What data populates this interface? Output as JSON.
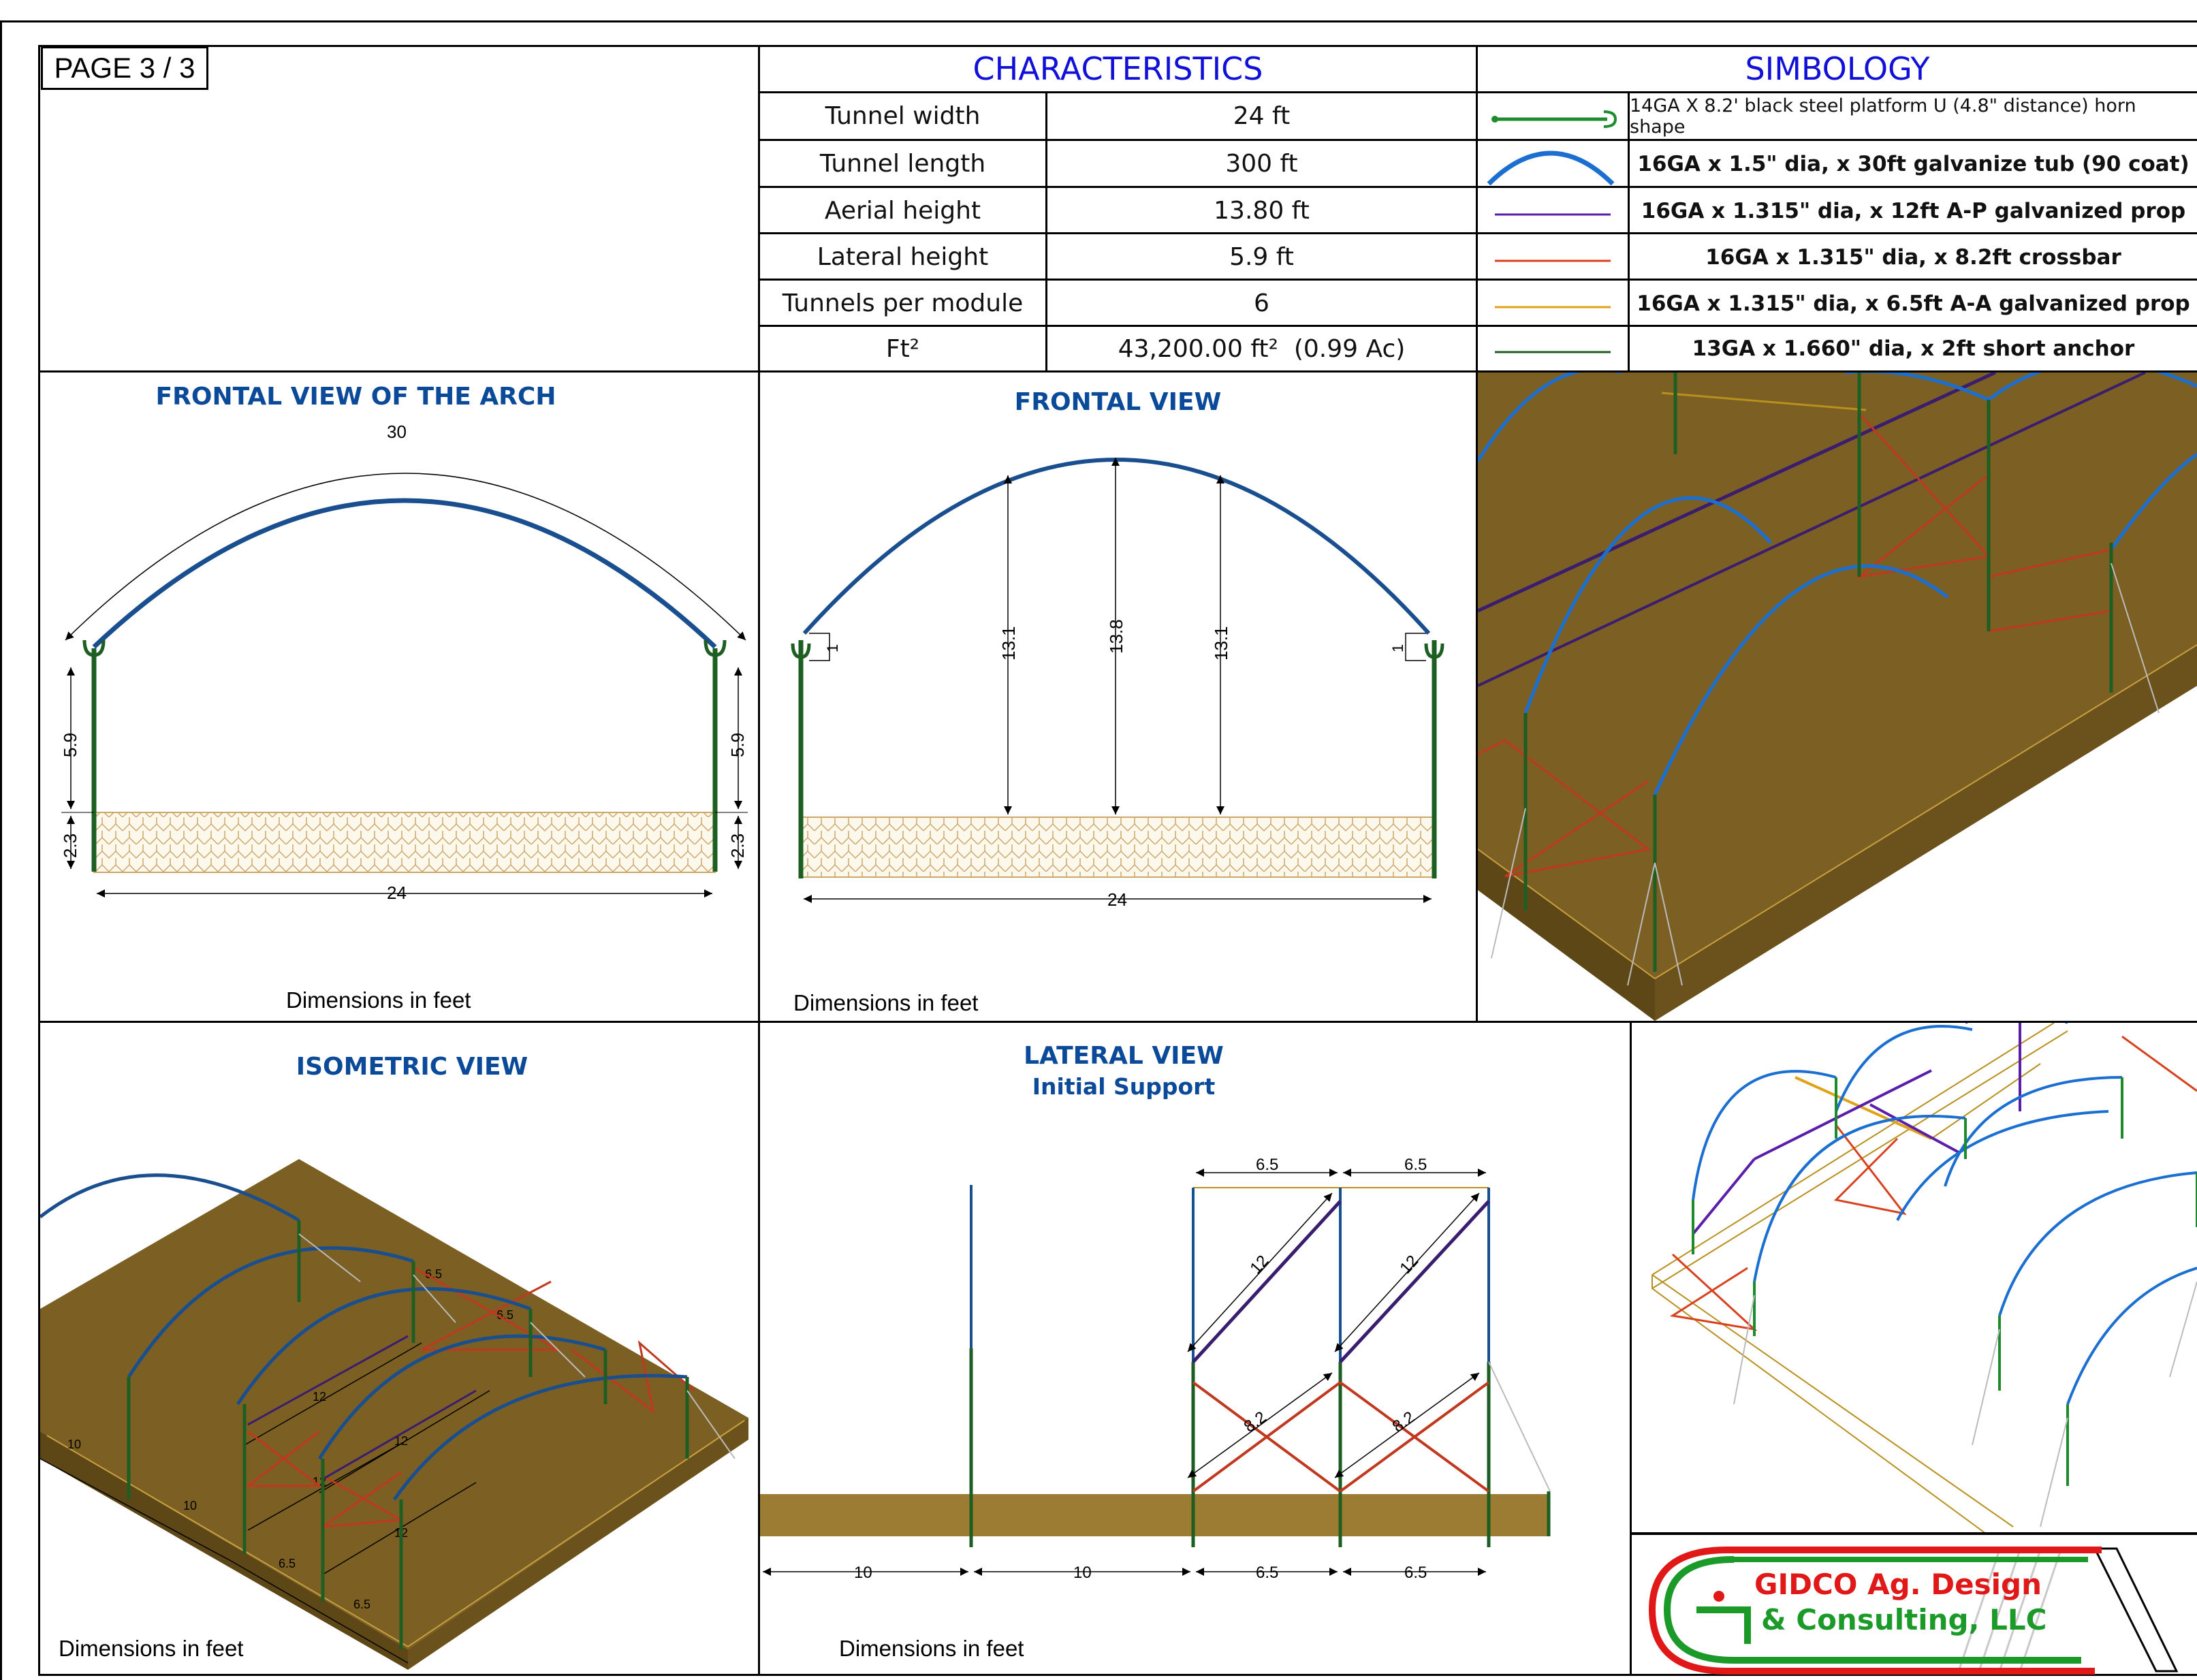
{
  "page": {
    "label": "PAGE 3 / 3"
  },
  "characteristics": {
    "title": "CHARACTERISTICS",
    "rows": [
      {
        "label": "Tunnel width",
        "value": "24 ft"
      },
      {
        "label": "Tunnel length",
        "value": "300 ft"
      },
      {
        "label": "Aerial height",
        "value": "13.80 ft"
      },
      {
        "label": "Lateral height",
        "value": "5.9 ft"
      },
      {
        "label": "Tunnels per module",
        "value": "6"
      },
      {
        "label": "Ft²",
        "value": "43,200.00 ft²  (0.99 Ac)"
      }
    ]
  },
  "symbology": {
    "title": "SIMBOLOGY",
    "items": [
      {
        "icon": "horn-platform-icon",
        "color": "#1f8a2e",
        "desc": "14GA X 8.2' black steel platform U (4.8\"  distance) horn shape"
      },
      {
        "icon": "arch-tube-icon",
        "color": "#1a6fd0",
        "desc": "16GA x 1.5\" dia, x 30ft galvanize tub (90 coat)"
      },
      {
        "icon": "purple-line-icon",
        "color": "#5a1ea8",
        "desc": "16GA x 1.315\" dia, x 12ft A-P galvanized prop"
      },
      {
        "icon": "red-line-icon",
        "color": "#d8401e",
        "desc": "16GA x 1.315\" dia, x 8.2ft crossbar"
      },
      {
        "icon": "orange-line-icon",
        "color": "#e0a317",
        "desc": "16GA x 1.315\" dia, x 6.5ft A-A galvanized prop"
      },
      {
        "icon": "green-line-icon",
        "color": "#1d5e22",
        "desc": "13GA x 1.660\" dia, x 2ft short anchor"
      }
    ]
  },
  "frontal_arch_view": {
    "title": "FRONTAL VIEW OF THE ARCH",
    "arc_label": "30",
    "height_label": "5.9",
    "depth_label": "2.3",
    "width_label": "24",
    "note": "Dimensions in feet"
  },
  "frontal_view": {
    "title": "FRONTAL VIEW",
    "side_label": "13.1",
    "center_label": "13.8",
    "small_label": "1",
    "width_label": "24",
    "note": "Dimensions in feet"
  },
  "isometric_view": {
    "title": "ISOMETRIC VIEW",
    "dim_labels": [
      "12",
      "12",
      "12",
      "12",
      "10",
      "10",
      "6.5",
      "6.5",
      "6.5",
      "6.5"
    ],
    "note": "Dimensions in feet"
  },
  "lateral_view": {
    "title": "LATERAL VIEW",
    "subtitle": "Initial Support",
    "top_labels": [
      "6.5",
      "6.5"
    ],
    "diag_labels": [
      "12",
      "12"
    ],
    "cross_labels": [
      "8.2",
      "8.2"
    ],
    "bottom_labels": [
      "10",
      "10",
      "6.5",
      "6.5"
    ],
    "note": "Dimensions in feet"
  },
  "logo": {
    "line1": "GIDCO Ag. Design",
    "line2": "& Consulting, LLC"
  },
  "colors": {
    "arch_blue": "#1a4f8f",
    "bright_blue": "#1a6fd0",
    "green": "#1d5e22",
    "soil": "#7c5f22",
    "soil_dark": "#5d4716",
    "red": "#c0381e",
    "purple": "#3a1d6e",
    "gold": "#c8a040"
  }
}
